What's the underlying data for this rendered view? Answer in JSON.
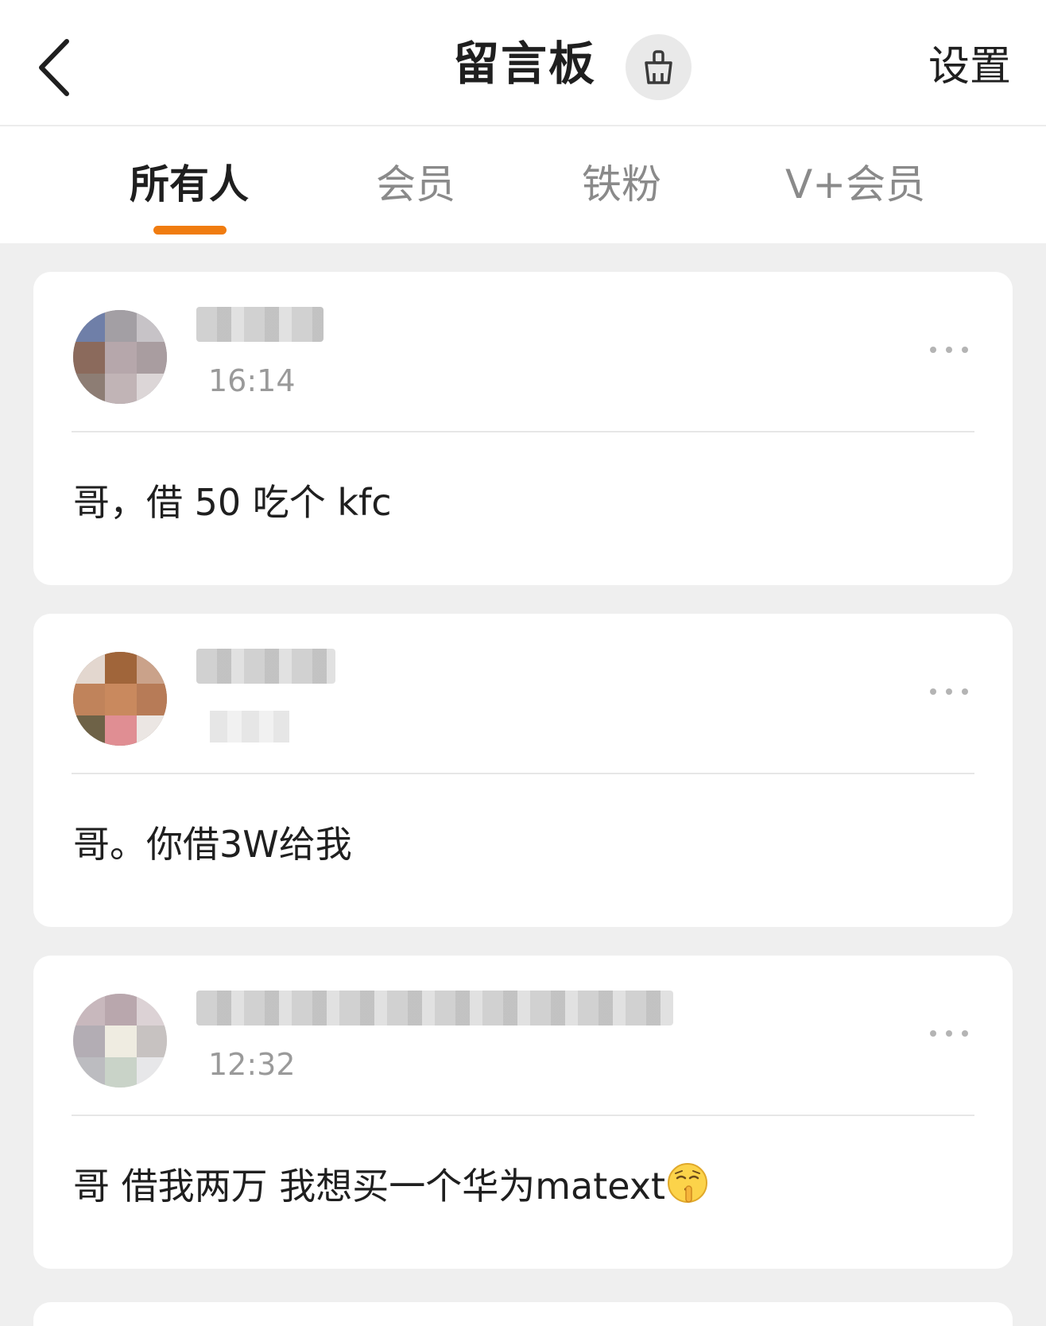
{
  "header": {
    "back_icon": "chevron-left-icon",
    "title": "留言板",
    "clean_icon": "broom-icon",
    "settings_label": "设置"
  },
  "tabs": [
    {
      "label": "所有人",
      "active": true
    },
    {
      "label": "会员",
      "active": false
    },
    {
      "label": "铁粉",
      "active": false
    },
    {
      "label": "V+会员",
      "active": false
    }
  ],
  "accent_color": "#f07c10",
  "messages": [
    {
      "time": "16:14",
      "text": "哥，借 50 吃个 kfc",
      "more_icon": "more-dots-icon"
    },
    {
      "time": "",
      "text": "哥。你借3W给我",
      "more_icon": "more-dots-icon"
    },
    {
      "time": "12:32",
      "text": "哥 借我两万 我想买一个华为matext",
      "emoji": "shushing-face-emoji",
      "more_icon": "more-dots-icon"
    }
  ]
}
